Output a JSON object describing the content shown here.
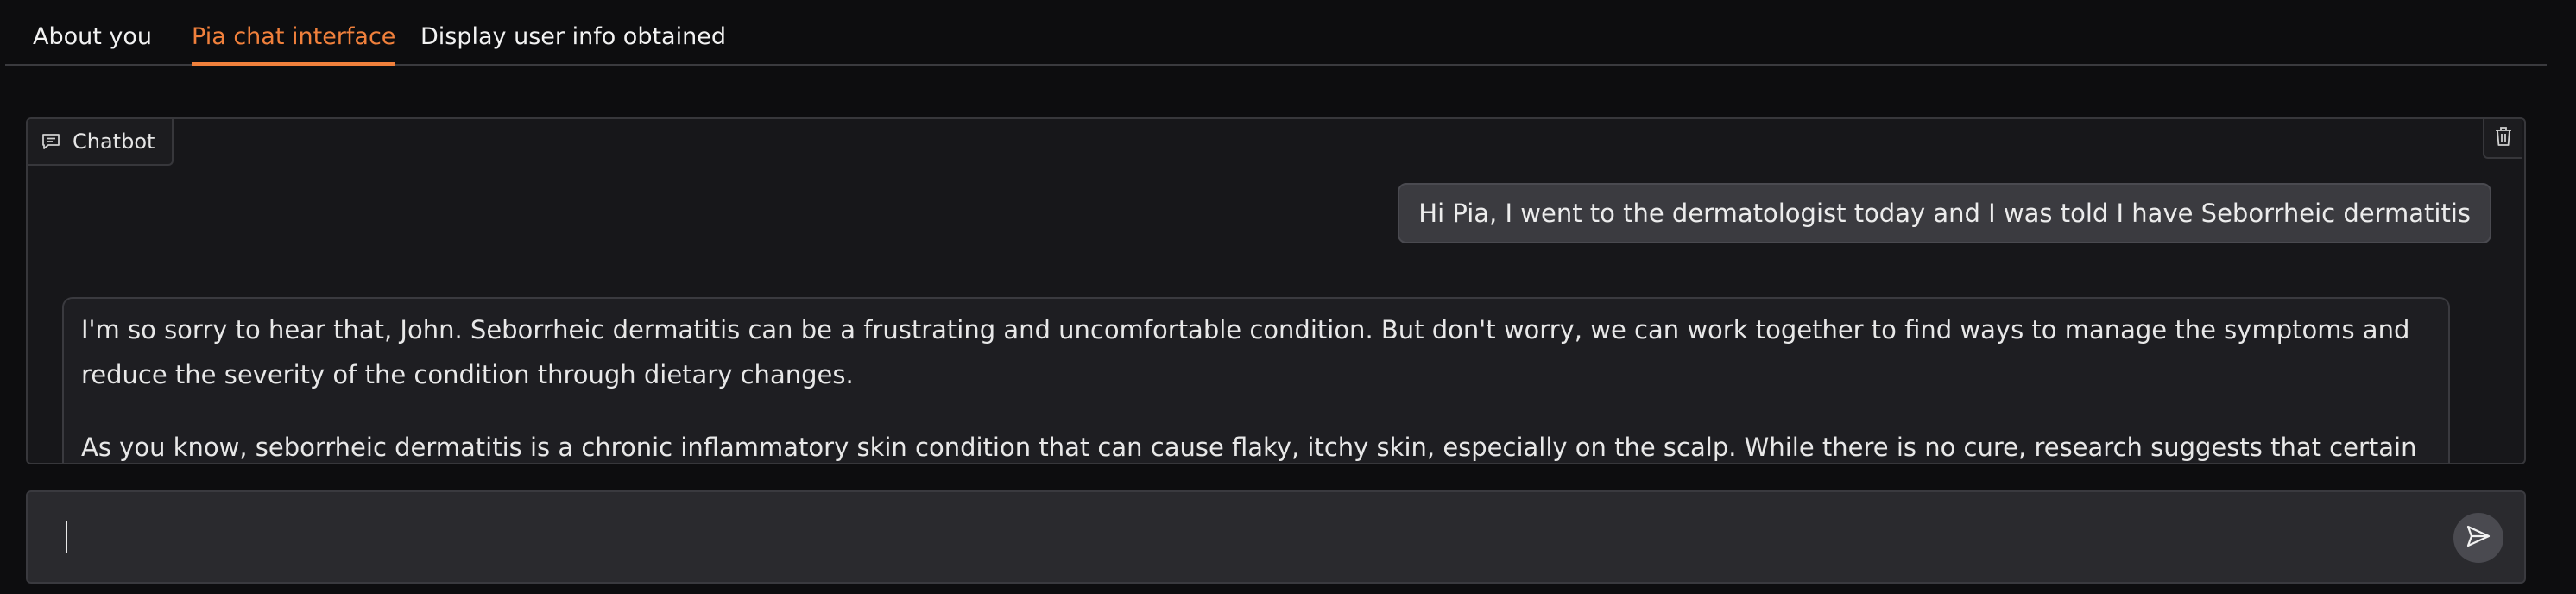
{
  "tabs": [
    {
      "label": "About you",
      "active": false
    },
    {
      "label": "Pia chat interface",
      "active": true
    },
    {
      "label": "Display user info obtained",
      "active": false
    }
  ],
  "chatbot": {
    "label": "Chatbot",
    "icon": "chat-bubble-icon",
    "clear_icon": "trash-icon"
  },
  "messages": {
    "user": "Hi Pia, I went to the dermatologist today and I was told I have Seborrheic dermatitis",
    "bot_paragraphs": [
      "I'm so sorry to hear that, John. Seborrheic dermatitis can be a frustrating and uncomfortable condition. But don't worry, we can work together to find ways to manage the symptoms and reduce the severity of the condition through dietary changes.",
      "As you know, seborrheic dermatitis is a chronic inflammatory skin condition that can cause flaky, itchy skin, especially on the scalp. While there is no cure, research suggests that certain foods and nutrients"
    ]
  },
  "input": {
    "value": "",
    "placeholder": ""
  },
  "send_icon": "send-icon",
  "colors": {
    "accent": "#f0803c",
    "background": "#0d0d0f",
    "panel": "#17171a",
    "user_bubble": "#3b3b40",
    "input_bg": "#2a2a2e"
  }
}
